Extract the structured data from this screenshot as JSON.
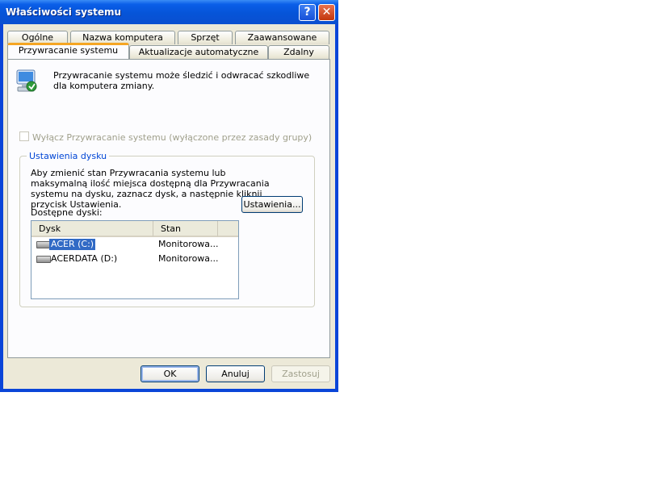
{
  "window": {
    "title": "Właściwości systemu",
    "help_button": "?",
    "close_button": "✕"
  },
  "tabs_row1": [
    "Ogólne",
    "Nazwa komputera",
    "Sprzęt",
    "Zaawansowane"
  ],
  "tabs_row2": [
    "Przywracanie systemu",
    "Aktualizacje automatyczne",
    "Zdalny"
  ],
  "active_tab": "Przywracanie systemu",
  "description": "Przywracanie systemu może śledzić i odwracać szkodliwe dla komputera zmiany.",
  "disable_checkbox": {
    "label": "Wyłącz Przywracanie systemu (wyłączone przez zasady grupy)",
    "checked": false,
    "enabled": false
  },
  "disk_settings": {
    "title": "Ustawienia dysku",
    "description": "Aby zmienić stan Przywracania systemu lub maksymalną ilość miejsca dostępną dla Przywracania systemu na dysku, zaznacz dysk, a następnie kliknij przycisk Ustawienia.",
    "available_label": "Dostępne dyski:",
    "columns": [
      "Dysk",
      "Stan"
    ],
    "rows": [
      {
        "disk": "ACER (C:)",
        "status": "Monitorowa...",
        "selected": true
      },
      {
        "disk": "ACERDATA (D:)",
        "status": "Monitorowa...",
        "selected": false
      }
    ],
    "settings_button": "Ustawienia..."
  },
  "footer": {
    "ok": "OK",
    "cancel": "Anuluj",
    "apply": "Zastosuj"
  },
  "colors": {
    "title_bar": "#0654d8",
    "selection": "#316ac5",
    "group_title": "#0046d5",
    "active_tab_accent": "#f5a623"
  },
  "icons": {
    "system_restore": "system-restore-icon",
    "drive": "hard-drive-icon"
  }
}
